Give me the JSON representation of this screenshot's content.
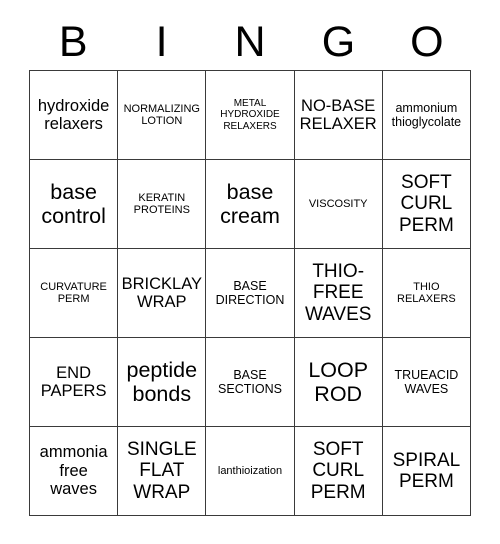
{
  "card": {
    "title_letters": [
      "B",
      "I",
      "N",
      "G",
      "O"
    ],
    "columns": 5,
    "rows": 5,
    "border_color": "#3a3a3a",
    "background_color": "#ffffff",
    "text_color": "#000000",
    "cells": [
      [
        {
          "text": "hydroxide\nrelaxers",
          "size": "md",
          "case": "lower"
        },
        {
          "text": "NORMALIZING\nLOTION",
          "size": "xs",
          "case": "upper"
        },
        {
          "text": "METAL\nHYDROXIDE\nRELAXERS",
          "size": "xxs",
          "case": "upper"
        },
        {
          "text": "NO-BASE\nRELAXER",
          "size": "md",
          "case": "upper"
        },
        {
          "text": "ammonium\nthioglycolate",
          "size": "sm",
          "case": "lower"
        }
      ],
      [
        {
          "text": "base\ncontrol",
          "size": "xl",
          "case": "lower"
        },
        {
          "text": "KERATIN\nPROTEINS",
          "size": "xs",
          "case": "upper"
        },
        {
          "text": "base\ncream",
          "size": "xl",
          "case": "lower"
        },
        {
          "text": "VISCOSITY",
          "size": "xs",
          "case": "upper"
        },
        {
          "text": "SOFT\nCURL\nPERM",
          "size": "lg",
          "case": "upper"
        }
      ],
      [
        {
          "text": "CURVATURE\nPERM",
          "size": "xs",
          "case": "upper"
        },
        {
          "text": "BRICKLAY\nWRAP",
          "size": "md",
          "case": "upper"
        },
        {
          "text": "BASE\nDIRECTION",
          "size": "sm",
          "case": "upper"
        },
        {
          "text": "THIO-\nFREE\nWAVES",
          "size": "lg",
          "case": "upper"
        },
        {
          "text": "THIO\nRELAXERS",
          "size": "xs",
          "case": "upper"
        }
      ],
      [
        {
          "text": "END\nPAPERS",
          "size": "md",
          "case": "upper"
        },
        {
          "text": "peptide\nbonds",
          "size": "xl",
          "case": "lower"
        },
        {
          "text": "BASE\nSECTIONS",
          "size": "sm",
          "case": "upper"
        },
        {
          "text": "LOOP\nROD",
          "size": "xl",
          "case": "upper"
        },
        {
          "text": "TRUEACID\nWAVES",
          "size": "sm",
          "case": "upper"
        }
      ],
      [
        {
          "text": "ammonia\nfree\nwaves",
          "size": "md",
          "case": "lower"
        },
        {
          "text": "SINGLE\nFLAT\nWRAP",
          "size": "lg",
          "case": "upper"
        },
        {
          "text": "lanthioization",
          "size": "xs",
          "case": "lower"
        },
        {
          "text": "SOFT\nCURL\nPERM",
          "size": "lg",
          "case": "upper"
        },
        {
          "text": "SPIRAL\nPERM",
          "size": "lg",
          "case": "upper"
        }
      ]
    ]
  }
}
